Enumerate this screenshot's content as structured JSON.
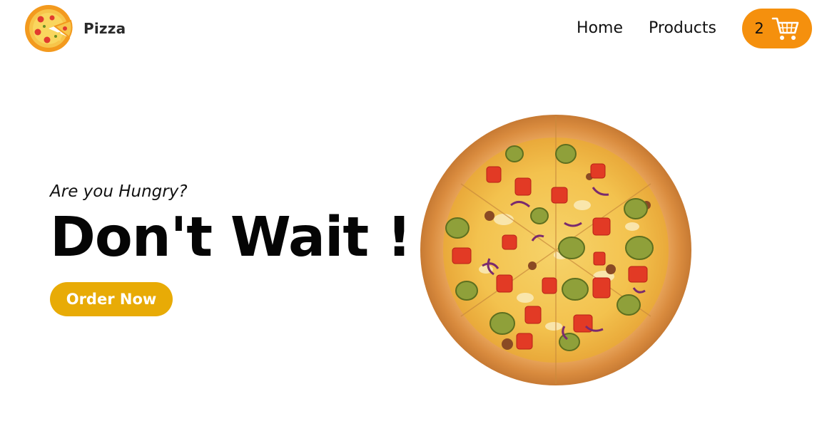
{
  "header": {
    "brand_name": "Pizza",
    "logo_icon": "pizza-logo-icon",
    "nav": {
      "home": "Home",
      "products": "Products"
    },
    "cart": {
      "count": "2",
      "icon": "shopping-cart-icon"
    }
  },
  "hero": {
    "tagline": "Are you Hungry?",
    "headline": "Don't Wait !",
    "cta_label": "Order Now",
    "image": "pizza-image"
  },
  "colors": {
    "cart_button": "#f5900d",
    "cta_button": "#e8ab06",
    "text": "#050505",
    "background": "#ffffff"
  }
}
